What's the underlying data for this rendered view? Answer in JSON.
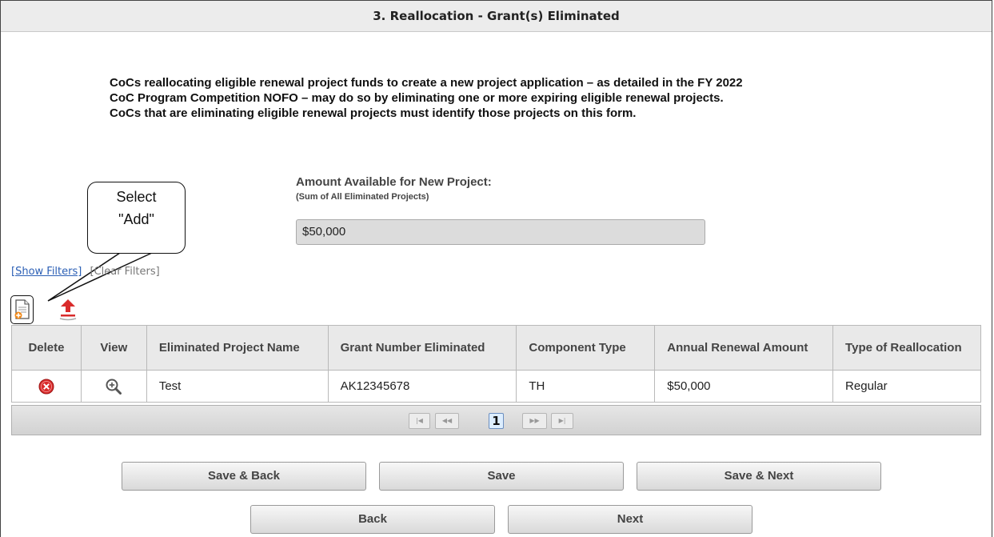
{
  "header": {
    "title": "3. Reallocation - Grant(s) Eliminated"
  },
  "intro": {
    "lines": [
      "CoCs reallocating eligible renewal project funds to create a new project application – as detailed in the FY 2022",
      "CoC Program Competition NOFO – may do so by eliminating one or more expiring eligible renewal projects.",
      "CoCs that are eliminating eligible renewal projects must identify those projects on this form."
    ]
  },
  "amount": {
    "label": "Amount Available for New Project:",
    "sublabel": "(Sum of All Eliminated Projects)",
    "value": "$50,000"
  },
  "callout": {
    "line1": "Select",
    "line2": "\"Add\""
  },
  "filters": {
    "show": "[Show Filters]",
    "clear": "[Clear Filters]"
  },
  "icons": {
    "add": "add-record-icon",
    "upload": "upload-icon",
    "delete": "delete-icon",
    "view": "magnify-icon"
  },
  "table": {
    "headers": [
      "Delete",
      "View",
      "Eliminated Project Name",
      "Grant Number Eliminated",
      "Component Type",
      "Annual Renewal Amount",
      "Type of Reallocation"
    ],
    "rows": [
      {
        "name": "Test",
        "grant": "AK12345678",
        "component": "TH",
        "amount": "$50,000",
        "type": "Regular"
      }
    ]
  },
  "pager": {
    "current": "1"
  },
  "buttons": {
    "save_back": "Save & Back",
    "save": "Save",
    "save_next": "Save & Next",
    "back": "Back",
    "next": "Next"
  },
  "colors": {
    "delete_red": "#d92b2b",
    "link_blue": "#2b5fb5",
    "header_bg": "#ececec"
  }
}
